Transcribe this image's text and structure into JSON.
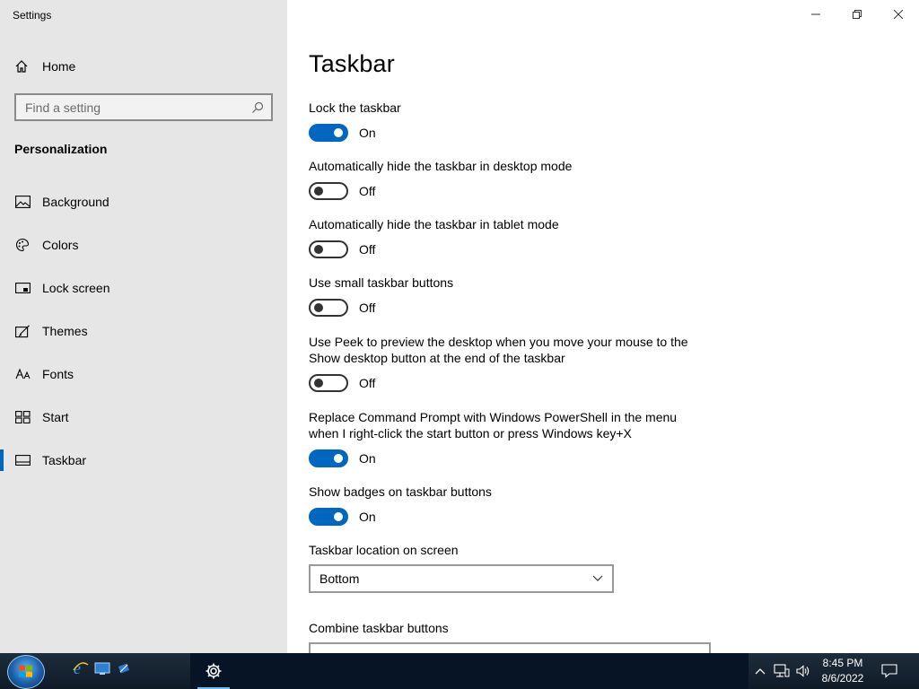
{
  "app": {
    "title": "Settings"
  },
  "sidebar": {
    "home_label": "Home",
    "search_placeholder": "Find a setting",
    "section_heading": "Personalization",
    "items": [
      {
        "label": "Background",
        "icon": "picture-icon"
      },
      {
        "label": "Colors",
        "icon": "palette-icon"
      },
      {
        "label": "Lock screen",
        "icon": "lock-screen-icon"
      },
      {
        "label": "Themes",
        "icon": "themes-icon"
      },
      {
        "label": "Fonts",
        "icon": "fonts-icon"
      },
      {
        "label": "Start",
        "icon": "start-icon"
      },
      {
        "label": "Taskbar",
        "icon": "taskbar-icon",
        "selected": true
      }
    ]
  },
  "main": {
    "title": "Taskbar",
    "settings": [
      {
        "label": "Lock the taskbar",
        "state": "On"
      },
      {
        "label": "Automatically hide the taskbar in desktop mode",
        "state": "Off"
      },
      {
        "label": "Automatically hide the taskbar in tablet mode",
        "state": "Off"
      },
      {
        "label": "Use small taskbar buttons",
        "state": "Off"
      },
      {
        "label": "Use Peek to preview the desktop when you move your mouse to the Show desktop button at the end of the taskbar",
        "state": "Off"
      },
      {
        "label": "Replace Command Prompt with Windows PowerShell in the menu when I right-click the start button or press Windows key+X",
        "state": "On"
      },
      {
        "label": "Show badges on taskbar buttons",
        "state": "On"
      }
    ],
    "location": {
      "label": "Taskbar location on screen",
      "value": "Bottom"
    },
    "combine": {
      "label": "Combine taskbar buttons"
    }
  },
  "taskbar": {
    "time": "8:45 PM",
    "date": "8/6/2022"
  },
  "colors": {
    "accent": "#0067c0",
    "sidebar_bg": "#e6e6e6",
    "taskbar_bg": "#0f1a26"
  }
}
